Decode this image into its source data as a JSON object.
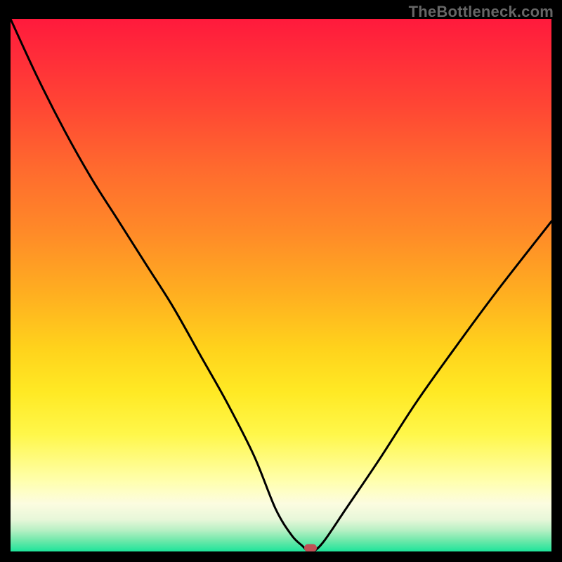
{
  "watermark": "TheBottleneck.com",
  "chart_data": {
    "type": "line",
    "title": "",
    "xlabel": "",
    "ylabel": "",
    "xlim": [
      0,
      100
    ],
    "ylim": [
      0,
      100
    ],
    "grid": false,
    "series": [
      {
        "name": "curve",
        "x": [
          0,
          5,
          10,
          15,
          20,
          25,
          30,
          35,
          40,
          45,
          49,
          52,
          54,
          55,
          56,
          58,
          62,
          68,
          75,
          82,
          90,
          100
        ],
        "values": [
          100,
          89,
          79,
          70,
          62,
          54,
          46,
          37,
          28,
          18,
          8,
          3,
          1,
          0,
          0,
          2,
          8,
          17,
          28,
          38,
          49,
          62
        ]
      }
    ],
    "marker": {
      "x": 55.5,
      "y": 0,
      "color": "#c05055"
    },
    "background_gradient": {
      "top": "#ff1a3c",
      "mid": "#ffd31c",
      "bottom": "#1ee49b"
    }
  }
}
